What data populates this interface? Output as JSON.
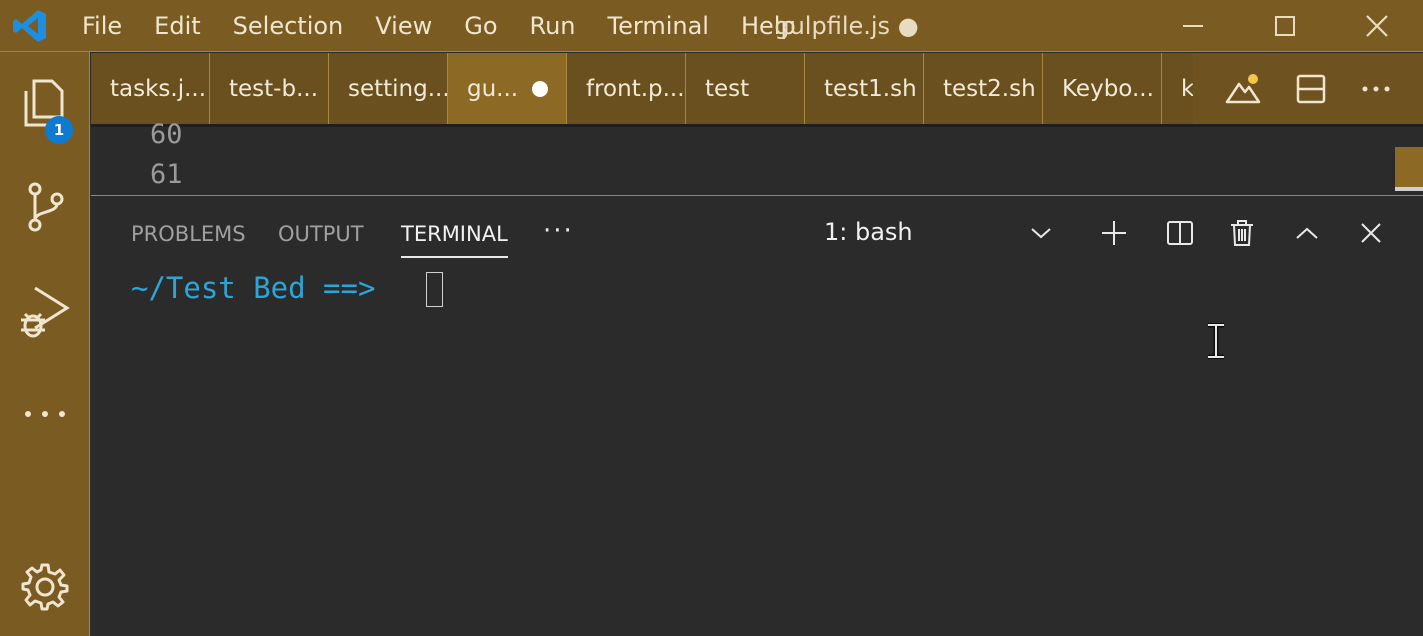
{
  "titlebar": {
    "menu": [
      "File",
      "Edit",
      "Selection",
      "View",
      "Go",
      "Run",
      "Terminal",
      "Help"
    ],
    "title": "gulpfile.js ●"
  },
  "activitybar": {
    "badge": "1"
  },
  "tabs": [
    {
      "label": "tasks.j..."
    },
    {
      "label": "test-b..."
    },
    {
      "label": "setting..."
    },
    {
      "label": "gu...",
      "active": true,
      "dirty": true
    },
    {
      "label": "front.p..."
    },
    {
      "label": "test"
    },
    {
      "label": "test1.sh"
    },
    {
      "label": "test2.sh"
    },
    {
      "label": "Keybo..."
    },
    {
      "label": "ke"
    }
  ],
  "editor": {
    "line_numbers": [
      "60",
      "61"
    ]
  },
  "panel": {
    "tabs": [
      "PROBLEMS",
      "OUTPUT",
      "TERMINAL"
    ],
    "active_tab": "TERMINAL",
    "more": "···",
    "terminal_select": "1: bash",
    "prompt": "~/Test Bed ==>"
  },
  "colors": {
    "accent": "#7a5c22",
    "badge": "#0e7ad1",
    "prompt": "#2aa6d9"
  }
}
